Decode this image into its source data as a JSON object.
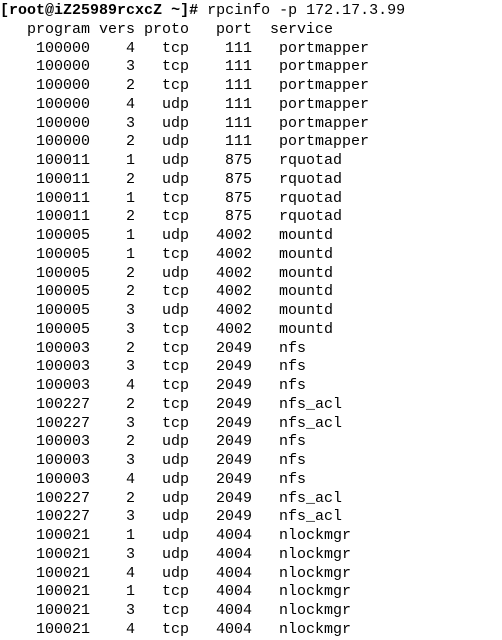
{
  "prompt": {
    "prefix": "[",
    "user": "root",
    "at": "@",
    "host": "iZ25989rcxcZ",
    "cwd": " ~",
    "suffix": "]# ",
    "command": "rpcinfo -p 172.17.3.99"
  },
  "header": {
    "program": "program",
    "vers": "vers",
    "proto": "proto",
    "port": "port",
    "service": "service"
  },
  "rows": [
    {
      "program": "100000",
      "vers": "4",
      "proto": "tcp",
      "port": "111",
      "service": "portmapper"
    },
    {
      "program": "100000",
      "vers": "3",
      "proto": "tcp",
      "port": "111",
      "service": "portmapper"
    },
    {
      "program": "100000",
      "vers": "2",
      "proto": "tcp",
      "port": "111",
      "service": "portmapper"
    },
    {
      "program": "100000",
      "vers": "4",
      "proto": "udp",
      "port": "111",
      "service": "portmapper"
    },
    {
      "program": "100000",
      "vers": "3",
      "proto": "udp",
      "port": "111",
      "service": "portmapper"
    },
    {
      "program": "100000",
      "vers": "2",
      "proto": "udp",
      "port": "111",
      "service": "portmapper"
    },
    {
      "program": "100011",
      "vers": "1",
      "proto": "udp",
      "port": "875",
      "service": "rquotad"
    },
    {
      "program": "100011",
      "vers": "2",
      "proto": "udp",
      "port": "875",
      "service": "rquotad"
    },
    {
      "program": "100011",
      "vers": "1",
      "proto": "tcp",
      "port": "875",
      "service": "rquotad"
    },
    {
      "program": "100011",
      "vers": "2",
      "proto": "tcp",
      "port": "875",
      "service": "rquotad"
    },
    {
      "program": "100005",
      "vers": "1",
      "proto": "udp",
      "port": "4002",
      "service": "mountd"
    },
    {
      "program": "100005",
      "vers": "1",
      "proto": "tcp",
      "port": "4002",
      "service": "mountd"
    },
    {
      "program": "100005",
      "vers": "2",
      "proto": "udp",
      "port": "4002",
      "service": "mountd"
    },
    {
      "program": "100005",
      "vers": "2",
      "proto": "tcp",
      "port": "4002",
      "service": "mountd"
    },
    {
      "program": "100005",
      "vers": "3",
      "proto": "udp",
      "port": "4002",
      "service": "mountd"
    },
    {
      "program": "100005",
      "vers": "3",
      "proto": "tcp",
      "port": "4002",
      "service": "mountd"
    },
    {
      "program": "100003",
      "vers": "2",
      "proto": "tcp",
      "port": "2049",
      "service": "nfs"
    },
    {
      "program": "100003",
      "vers": "3",
      "proto": "tcp",
      "port": "2049",
      "service": "nfs"
    },
    {
      "program": "100003",
      "vers": "4",
      "proto": "tcp",
      "port": "2049",
      "service": "nfs"
    },
    {
      "program": "100227",
      "vers": "2",
      "proto": "tcp",
      "port": "2049",
      "service": "nfs_acl"
    },
    {
      "program": "100227",
      "vers": "3",
      "proto": "tcp",
      "port": "2049",
      "service": "nfs_acl"
    },
    {
      "program": "100003",
      "vers": "2",
      "proto": "udp",
      "port": "2049",
      "service": "nfs"
    },
    {
      "program": "100003",
      "vers": "3",
      "proto": "udp",
      "port": "2049",
      "service": "nfs"
    },
    {
      "program": "100003",
      "vers": "4",
      "proto": "udp",
      "port": "2049",
      "service": "nfs"
    },
    {
      "program": "100227",
      "vers": "2",
      "proto": "udp",
      "port": "2049",
      "service": "nfs_acl"
    },
    {
      "program": "100227",
      "vers": "3",
      "proto": "udp",
      "port": "2049",
      "service": "nfs_acl"
    },
    {
      "program": "100021",
      "vers": "1",
      "proto": "udp",
      "port": "4004",
      "service": "nlockmgr"
    },
    {
      "program": "100021",
      "vers": "3",
      "proto": "udp",
      "port": "4004",
      "service": "nlockmgr"
    },
    {
      "program": "100021",
      "vers": "4",
      "proto": "udp",
      "port": "4004",
      "service": "nlockmgr"
    },
    {
      "program": "100021",
      "vers": "1",
      "proto": "tcp",
      "port": "4004",
      "service": "nlockmgr"
    },
    {
      "program": "100021",
      "vers": "3",
      "proto": "tcp",
      "port": "4004",
      "service": "nlockmgr"
    },
    {
      "program": "100021",
      "vers": "4",
      "proto": "tcp",
      "port": "4004",
      "service": "nlockmgr"
    }
  ]
}
